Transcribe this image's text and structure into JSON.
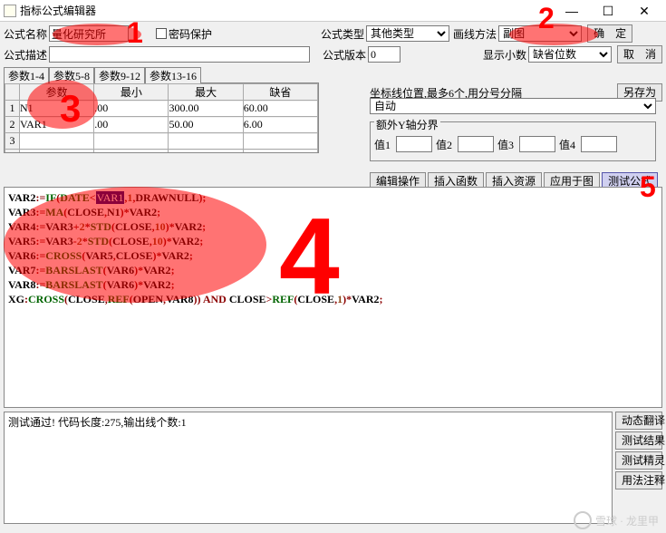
{
  "title": "指标公式编辑器",
  "win_btns": {
    "min": "—",
    "max": "☐",
    "close": "✕"
  },
  "labels": {
    "name": "公式名称",
    "pw": "密码保护",
    "ft": "公式类型",
    "lm": "画线方法",
    "ok": "确　定",
    "desc": "公式描述",
    "ver": "公式版本",
    "dec": "显示小数",
    "cancel": "取　消",
    "saveas": "另存为",
    "auto": "自动",
    "y_extra": "额外Y轴分界",
    "v1": "值1",
    "v2": "值2",
    "v3": "值3",
    "v4": "值4",
    "coord_hint": "坐标线位置,最多6个,用分号分隔"
  },
  "fields": {
    "name": "量化研究所",
    "desc": "",
    "ver": "0",
    "ft": "其他类型",
    "lm": "副图",
    "dec": "缺省位数",
    "coord": "",
    "v1": "",
    "v2": "",
    "v3": "",
    "v4": ""
  },
  "tabs": {
    "t1": "参数1-4",
    "t2": "参数5-8",
    "t3": "参数9-12",
    "t4": "参数13-16"
  },
  "param_hdr": {
    "p": "参数",
    "min": "最小",
    "max": "最大",
    "def": "缺省"
  },
  "params": [
    {
      "name": "N1",
      "min": ".00",
      "max": "300.00",
      "def": "60.00"
    },
    {
      "name": "VAR1",
      "min": ".00",
      "max": "50.00",
      "def": "6.00"
    },
    {
      "name": "",
      "min": "",
      "max": "",
      "def": ""
    },
    {
      "name": "",
      "min": "",
      "max": "",
      "def": ""
    }
  ],
  "btns": {
    "edit": "编辑操作",
    "fn": "插入函数",
    "res": "插入资源",
    "apply": "应用于图",
    "test": "测试公式"
  },
  "output": "测试通过! 代码长度:275,输出线个数:1",
  "side": {
    "dyn": "动态翻译",
    "res": "测试结果",
    "spirit": "测试精灵",
    "usage": "用法注释"
  },
  "annot": {
    "a1": "1",
    "a2": "2",
    "a3": "3",
    "a4": "4",
    "a5": "5"
  },
  "code_lines": [
    [
      [
        "id",
        "VAR2"
      ],
      [
        "op",
        ":="
      ],
      [
        "fn",
        "IF"
      ],
      [
        "op",
        "("
      ],
      [
        "fn",
        "DATE"
      ],
      [
        "op",
        "<"
      ],
      [
        "sel",
        "VAR1"
      ],
      [
        "op",
        ","
      ],
      [
        "num",
        "1"
      ],
      [
        "op",
        ","
      ],
      [
        "id",
        "DRAWNULL"
      ],
      [
        "op",
        ")"
      ],
      [
        "op",
        ";"
      ]
    ],
    [
      [
        "id",
        "VAR3"
      ],
      [
        "op",
        ":="
      ],
      [
        "fn",
        "MA"
      ],
      [
        "op",
        "("
      ],
      [
        "id",
        "CLOSE"
      ],
      [
        "op",
        ","
      ],
      [
        "id",
        "N1"
      ],
      [
        "op",
        ")"
      ],
      [
        "op",
        "*"
      ],
      [
        "id",
        "VAR2"
      ],
      [
        "op",
        ";"
      ]
    ],
    [
      [
        "id",
        "VAR4"
      ],
      [
        "op",
        ":="
      ],
      [
        "id",
        "VAR3"
      ],
      [
        "op",
        "+"
      ],
      [
        "num",
        "2"
      ],
      [
        "op",
        "*"
      ],
      [
        "fn",
        "STD"
      ],
      [
        "op",
        "("
      ],
      [
        "id",
        "CLOSE"
      ],
      [
        "op",
        ","
      ],
      [
        "num",
        "10"
      ],
      [
        "op",
        ")"
      ],
      [
        "op",
        "*"
      ],
      [
        "id",
        "VAR2"
      ],
      [
        "op",
        ";"
      ]
    ],
    [
      [
        "id",
        "VAR5"
      ],
      [
        "op",
        ":="
      ],
      [
        "id",
        "VAR3"
      ],
      [
        "op",
        "-"
      ],
      [
        "num",
        "2"
      ],
      [
        "op",
        "*"
      ],
      [
        "fn",
        "STD"
      ],
      [
        "op",
        "("
      ],
      [
        "id",
        "CLOSE"
      ],
      [
        "op",
        ","
      ],
      [
        "num",
        "10"
      ],
      [
        "op",
        ")"
      ],
      [
        "op",
        "*"
      ],
      [
        "id",
        "VAR2"
      ],
      [
        "op",
        ";"
      ]
    ],
    [
      [
        "id",
        "VAR6"
      ],
      [
        "op",
        ":="
      ],
      [
        "fn",
        "CROSS"
      ],
      [
        "op",
        "("
      ],
      [
        "id",
        "VAR5"
      ],
      [
        "op",
        ","
      ],
      [
        "id",
        "CLOSE"
      ],
      [
        "op",
        ")"
      ],
      [
        "op",
        "*"
      ],
      [
        "id",
        "VAR2"
      ],
      [
        "op",
        ";"
      ]
    ],
    [
      [
        "id",
        "VAR7"
      ],
      [
        "op",
        ":="
      ],
      [
        "fn",
        "BARSLAST"
      ],
      [
        "op",
        "("
      ],
      [
        "id",
        "VAR6"
      ],
      [
        "op",
        ")"
      ],
      [
        "op",
        "*"
      ],
      [
        "id",
        "VAR2"
      ],
      [
        "op",
        ";"
      ]
    ],
    [
      [
        "id",
        "VAR8"
      ],
      [
        "op",
        ":="
      ],
      [
        "fn",
        "BARSLAST"
      ],
      [
        "op",
        "("
      ],
      [
        "id",
        "VAR6"
      ],
      [
        "op",
        ")"
      ],
      [
        "op",
        "*"
      ],
      [
        "id",
        "VAR2"
      ],
      [
        "op",
        ";"
      ]
    ],
    [
      [
        "id",
        "XG"
      ],
      [
        "op",
        ":"
      ],
      [
        "fn",
        "CROSS"
      ],
      [
        "op",
        "("
      ],
      [
        "id",
        "CLOSE"
      ],
      [
        "op",
        ","
      ],
      [
        "fn",
        "REF"
      ],
      [
        "op",
        "("
      ],
      [
        "id",
        "OPEN"
      ],
      [
        "op",
        ","
      ],
      [
        "id",
        "VAR8"
      ],
      [
        "op",
        ")"
      ],
      [
        "op",
        ")"
      ],
      [
        "id",
        " "
      ],
      [
        "kw",
        "AND"
      ],
      [
        "id",
        " "
      ],
      [
        "id",
        "CLOSE"
      ],
      [
        "op",
        ">"
      ],
      [
        "fn",
        "REF"
      ],
      [
        "op",
        "("
      ],
      [
        "id",
        "CLOSE"
      ],
      [
        "op",
        ","
      ],
      [
        "num",
        "1"
      ],
      [
        "op",
        ")"
      ],
      [
        "op",
        "*"
      ],
      [
        "id",
        "VAR2"
      ],
      [
        "op",
        ";"
      ]
    ]
  ],
  "watermark": "雪球 · 龙里甲"
}
